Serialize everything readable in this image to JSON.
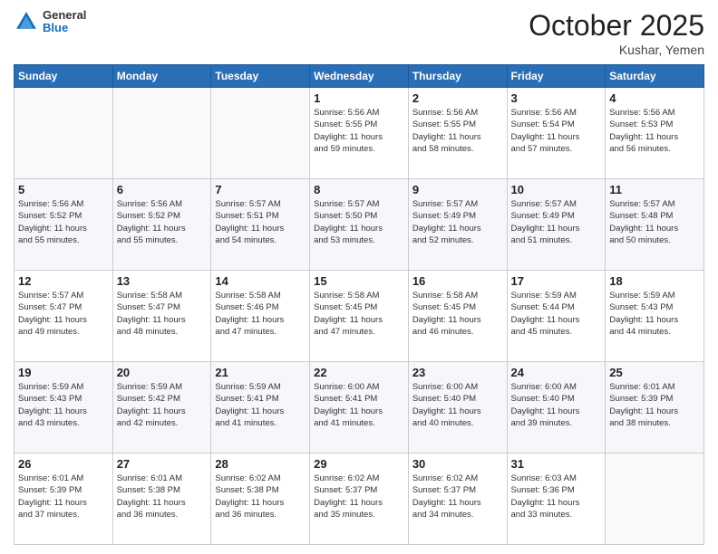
{
  "header": {
    "logo_general": "General",
    "logo_blue": "Blue",
    "month": "October 2025",
    "location": "Kushar, Yemen"
  },
  "weekdays": [
    "Sunday",
    "Monday",
    "Tuesday",
    "Wednesday",
    "Thursday",
    "Friday",
    "Saturday"
  ],
  "weeks": [
    [
      {
        "day": "",
        "info": ""
      },
      {
        "day": "",
        "info": ""
      },
      {
        "day": "",
        "info": ""
      },
      {
        "day": "1",
        "info": "Sunrise: 5:56 AM\nSunset: 5:55 PM\nDaylight: 11 hours\nand 59 minutes."
      },
      {
        "day": "2",
        "info": "Sunrise: 5:56 AM\nSunset: 5:55 PM\nDaylight: 11 hours\nand 58 minutes."
      },
      {
        "day": "3",
        "info": "Sunrise: 5:56 AM\nSunset: 5:54 PM\nDaylight: 11 hours\nand 57 minutes."
      },
      {
        "day": "4",
        "info": "Sunrise: 5:56 AM\nSunset: 5:53 PM\nDaylight: 11 hours\nand 56 minutes."
      }
    ],
    [
      {
        "day": "5",
        "info": "Sunrise: 5:56 AM\nSunset: 5:52 PM\nDaylight: 11 hours\nand 55 minutes."
      },
      {
        "day": "6",
        "info": "Sunrise: 5:56 AM\nSunset: 5:52 PM\nDaylight: 11 hours\nand 55 minutes."
      },
      {
        "day": "7",
        "info": "Sunrise: 5:57 AM\nSunset: 5:51 PM\nDaylight: 11 hours\nand 54 minutes."
      },
      {
        "day": "8",
        "info": "Sunrise: 5:57 AM\nSunset: 5:50 PM\nDaylight: 11 hours\nand 53 minutes."
      },
      {
        "day": "9",
        "info": "Sunrise: 5:57 AM\nSunset: 5:49 PM\nDaylight: 11 hours\nand 52 minutes."
      },
      {
        "day": "10",
        "info": "Sunrise: 5:57 AM\nSunset: 5:49 PM\nDaylight: 11 hours\nand 51 minutes."
      },
      {
        "day": "11",
        "info": "Sunrise: 5:57 AM\nSunset: 5:48 PM\nDaylight: 11 hours\nand 50 minutes."
      }
    ],
    [
      {
        "day": "12",
        "info": "Sunrise: 5:57 AM\nSunset: 5:47 PM\nDaylight: 11 hours\nand 49 minutes."
      },
      {
        "day": "13",
        "info": "Sunrise: 5:58 AM\nSunset: 5:47 PM\nDaylight: 11 hours\nand 48 minutes."
      },
      {
        "day": "14",
        "info": "Sunrise: 5:58 AM\nSunset: 5:46 PM\nDaylight: 11 hours\nand 47 minutes."
      },
      {
        "day": "15",
        "info": "Sunrise: 5:58 AM\nSunset: 5:45 PM\nDaylight: 11 hours\nand 47 minutes."
      },
      {
        "day": "16",
        "info": "Sunrise: 5:58 AM\nSunset: 5:45 PM\nDaylight: 11 hours\nand 46 minutes."
      },
      {
        "day": "17",
        "info": "Sunrise: 5:59 AM\nSunset: 5:44 PM\nDaylight: 11 hours\nand 45 minutes."
      },
      {
        "day": "18",
        "info": "Sunrise: 5:59 AM\nSunset: 5:43 PM\nDaylight: 11 hours\nand 44 minutes."
      }
    ],
    [
      {
        "day": "19",
        "info": "Sunrise: 5:59 AM\nSunset: 5:43 PM\nDaylight: 11 hours\nand 43 minutes."
      },
      {
        "day": "20",
        "info": "Sunrise: 5:59 AM\nSunset: 5:42 PM\nDaylight: 11 hours\nand 42 minutes."
      },
      {
        "day": "21",
        "info": "Sunrise: 5:59 AM\nSunset: 5:41 PM\nDaylight: 11 hours\nand 41 minutes."
      },
      {
        "day": "22",
        "info": "Sunrise: 6:00 AM\nSunset: 5:41 PM\nDaylight: 11 hours\nand 41 minutes."
      },
      {
        "day": "23",
        "info": "Sunrise: 6:00 AM\nSunset: 5:40 PM\nDaylight: 11 hours\nand 40 minutes."
      },
      {
        "day": "24",
        "info": "Sunrise: 6:00 AM\nSunset: 5:40 PM\nDaylight: 11 hours\nand 39 minutes."
      },
      {
        "day": "25",
        "info": "Sunrise: 6:01 AM\nSunset: 5:39 PM\nDaylight: 11 hours\nand 38 minutes."
      }
    ],
    [
      {
        "day": "26",
        "info": "Sunrise: 6:01 AM\nSunset: 5:39 PM\nDaylight: 11 hours\nand 37 minutes."
      },
      {
        "day": "27",
        "info": "Sunrise: 6:01 AM\nSunset: 5:38 PM\nDaylight: 11 hours\nand 36 minutes."
      },
      {
        "day": "28",
        "info": "Sunrise: 6:02 AM\nSunset: 5:38 PM\nDaylight: 11 hours\nand 36 minutes."
      },
      {
        "day": "29",
        "info": "Sunrise: 6:02 AM\nSunset: 5:37 PM\nDaylight: 11 hours\nand 35 minutes."
      },
      {
        "day": "30",
        "info": "Sunrise: 6:02 AM\nSunset: 5:37 PM\nDaylight: 11 hours\nand 34 minutes."
      },
      {
        "day": "31",
        "info": "Sunrise: 6:03 AM\nSunset: 5:36 PM\nDaylight: 11 hours\nand 33 minutes."
      },
      {
        "day": "",
        "info": ""
      }
    ]
  ]
}
